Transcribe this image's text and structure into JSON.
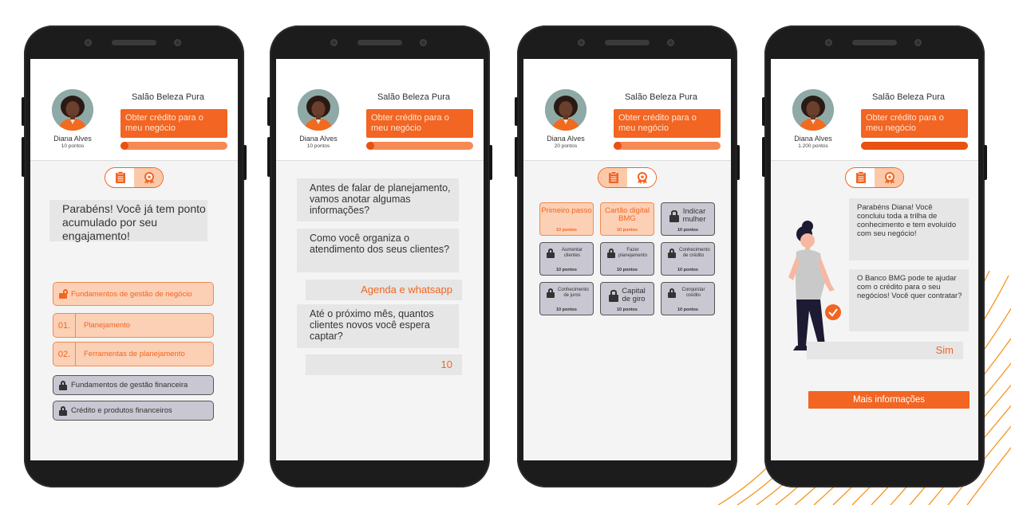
{
  "colors": {
    "accent": "#f26522",
    "accent_light": "#fbd0b5",
    "locked": "#c9c7d2",
    "bubble": "#e6e6e6",
    "frame": "#1c1c1c"
  },
  "profile": {
    "salon": "Salão Beleza Pura",
    "credit_button": "Obter crédito para o meu negócio",
    "name": "Diana Alves"
  },
  "screens": [
    {
      "points": "10 pontos",
      "progress": 0.07,
      "active_tab": "right",
      "chat": "Parabéns! Você já tem ponto acumulado por seu engajamento!",
      "modules": [
        {
          "label": "Fundamentos de gestão de negócio",
          "state": "unlocked",
          "icon": "unlock-icon"
        },
        {
          "num": "01.",
          "label": "Planejamento",
          "state": "open"
        },
        {
          "num": "02.",
          "label": "Ferramentas de planejamento",
          "state": "open"
        },
        {
          "label": "Fundamentos de gestão financeira",
          "state": "locked",
          "icon": "lock-icon"
        },
        {
          "label": "Crédito e produtos financeiros",
          "state": "locked",
          "icon": "lock-icon"
        }
      ]
    },
    {
      "points": "10 pontos",
      "progress": 0.07,
      "messages": [
        {
          "type": "question",
          "text": "Antes de falar de planejamento, vamos anotar algumas informações?"
        },
        {
          "type": "question",
          "text": "Como você organiza o atendimento dos seus clientes?"
        },
        {
          "type": "answer",
          "text": "Agenda e whatsapp"
        },
        {
          "type": "question",
          "text": "Até o próximo mês, quantos clientes novos você espera captar?"
        },
        {
          "type": "answer",
          "text": "10"
        }
      ]
    },
    {
      "points": "20 pontos",
      "progress": 0.07,
      "active_tab": "left",
      "badges": [
        {
          "title": "Primeiro passo",
          "points": "10 pontos",
          "state": "open"
        },
        {
          "title": "Cartão digital BMG",
          "points": "10 pontos",
          "state": "open"
        },
        {
          "title": "Indicar mulher",
          "points": "10 pontos",
          "state": "locked",
          "size": "big"
        },
        {
          "title": "Aumentar clientes",
          "points": "10 pontos",
          "state": "locked",
          "size": "small"
        },
        {
          "title": "Fazer planejamento",
          "points": "10 pontos",
          "state": "locked",
          "size": "small"
        },
        {
          "title": "Conhecimento de crédito",
          "points": "10 pontos",
          "state": "locked",
          "size": "small"
        },
        {
          "title": "Conhecimento de juros",
          "points": "10 pontos",
          "state": "locked",
          "size": "small"
        },
        {
          "title": "Capital de giro",
          "points": "10 pontos",
          "state": "locked",
          "size": "big"
        },
        {
          "title": "Conquistar crédito",
          "points": "10 pontos",
          "state": "locked",
          "size": "small"
        }
      ]
    },
    {
      "points": "1.200 pontos",
      "progress": 1.0,
      "active_tab": "right",
      "messages": [
        "Parabéns Diana! Você concluiu toda a trilha de conhecimento e tem evoluído com seu negócio!",
        "O Banco BMG pode te ajudar com o crédito para o seu negócios! Você quer contratar?"
      ],
      "answer": "Sim",
      "more_button": "Mais informações"
    }
  ]
}
